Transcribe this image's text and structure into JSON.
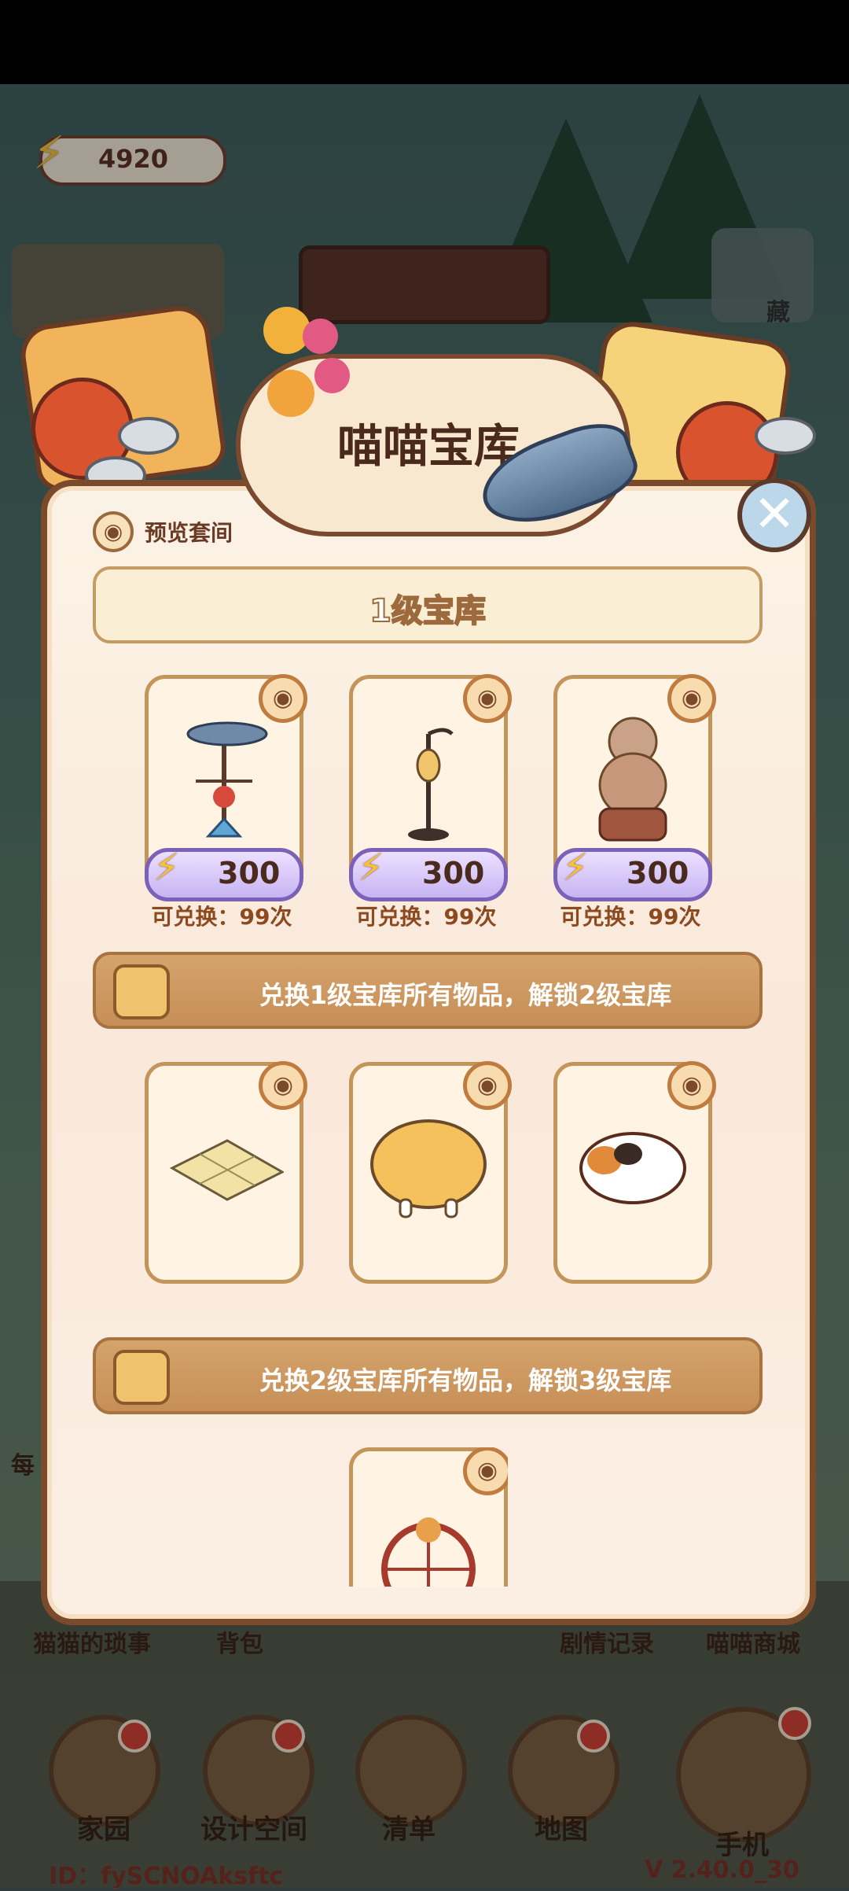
{
  "energy": {
    "value": "4920"
  },
  "background": {
    "top_right_label": "藏",
    "menu_labels": [
      "猫猫的琐事",
      "背包",
      "剧情记录",
      "喵喵商城"
    ],
    "side_label": "每",
    "nav": [
      "家园",
      "设计空间",
      "清单",
      "地图",
      "手机"
    ],
    "footer_id": "ID：fySCNOAksftc",
    "version": "V 2.40.0_30"
  },
  "modal": {
    "title": "喵喵宝库",
    "preview_label": "预览套间",
    "tier1": {
      "title": "1级宝库",
      "items": [
        {
          "name": "fish weathervane",
          "price": "300",
          "exchange": "可兑换：99次"
        },
        {
          "name": "cat street lamp",
          "price": "300",
          "exchange": "可兑换：99次"
        },
        {
          "name": "cat statue",
          "price": "300",
          "exchange": "可兑换：99次"
        }
      ]
    },
    "lock1": {
      "text": "兑换1级宝库所有物品，解锁2级宝库"
    },
    "tier2": {
      "items": [
        {
          "name": "cat patterned rug"
        },
        {
          "name": "round cushion stool"
        },
        {
          "name": "calico cat rug"
        }
      ]
    },
    "lock2": {
      "text": "兑换2级宝库所有物品，解锁3级宝库"
    },
    "tier3": {
      "items": [
        {
          "name": "cat ferris wheel"
        }
      ]
    }
  },
  "colors": {
    "brand_brown": "#7a4a2a",
    "price_purple": "#c7b4f2",
    "lock_bar": "#c68f57",
    "energy_yellow": "#f5c23a"
  }
}
